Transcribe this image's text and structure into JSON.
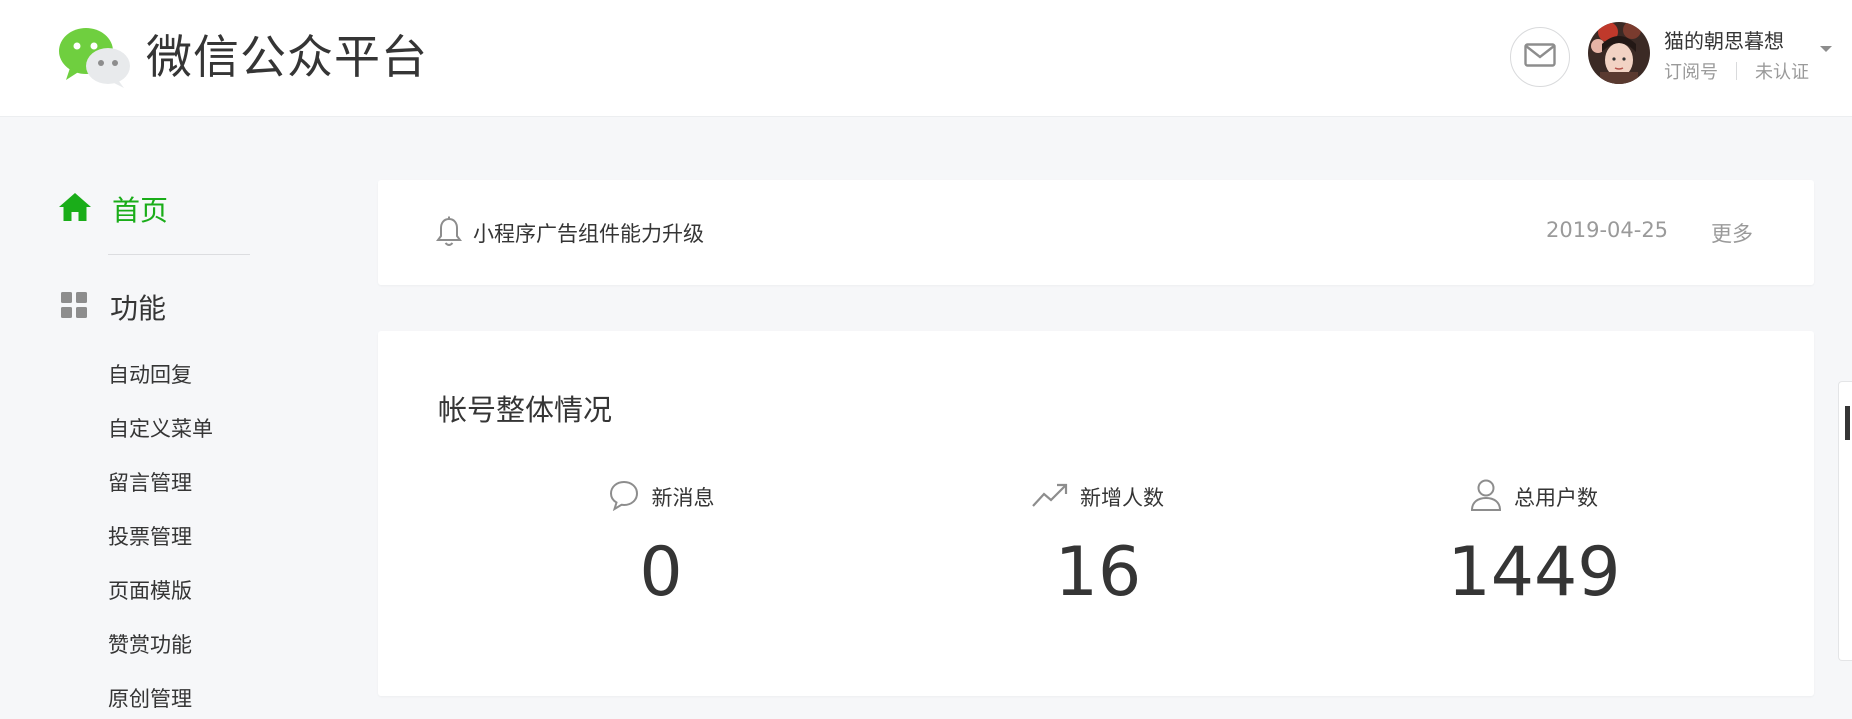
{
  "header": {
    "title": "微信公众平台",
    "account": {
      "name": "猫的朝思暮想",
      "type": "订阅号",
      "verify_status": "未认证"
    }
  },
  "icons": {
    "logo": "wechat-logo-icon",
    "mail": "mail-icon",
    "home": "home-icon",
    "func": "grid-icon",
    "bell": "bell-icon",
    "message": "chat-bubble-icon",
    "trend": "trend-up-icon",
    "user": "user-icon"
  },
  "colors": {
    "accent": "#1aad19",
    "text": "#353535",
    "muted": "#9a9a9a",
    "background": "#f6f7f9"
  },
  "sidebar": {
    "home_label": "首页",
    "func_label": "功能",
    "sub_items": [
      "自动回复",
      "自定义菜单",
      "留言管理",
      "投票管理",
      "页面模版",
      "赞赏功能",
      "原创管理"
    ]
  },
  "notice": {
    "text": "小程序广告组件能力升级",
    "date": "2019-04-25",
    "more": "更多"
  },
  "stats": {
    "title": "帐号整体情况",
    "items": [
      {
        "label": "新消息",
        "value": "0"
      },
      {
        "label": "新增人数",
        "value": "16"
      },
      {
        "label": "总用户数",
        "value": "1449"
      }
    ]
  }
}
